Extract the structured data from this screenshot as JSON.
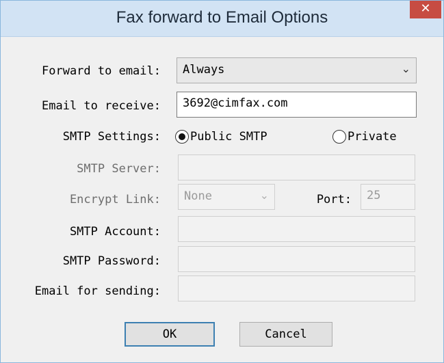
{
  "window": {
    "title": "Fax forward to Email Options",
    "close_glyph": "✕"
  },
  "form": {
    "forward_label": "Forward to email:",
    "forward_value": "Always",
    "forward_arrow": "⌄",
    "email_receive_label": "Email to receive:",
    "email_receive_value": "3692@cimfax.com",
    "smtp_settings_label": "SMTP Settings:",
    "smtp_public_label": "Public SMTP",
    "smtp_public_checked": true,
    "smtp_private_label": "Private",
    "smtp_private_checked": false,
    "smtp_server_label": "SMTP Server:",
    "smtp_server_value": "",
    "encrypt_label": "Encrypt Link:",
    "encrypt_value": "None",
    "encrypt_arrow": "⌄",
    "port_label": "Port:",
    "port_value": "25",
    "smtp_account_label": "SMTP Account:",
    "smtp_account_value": "",
    "smtp_password_label": "SMTP Password:",
    "smtp_password_value": "",
    "email_sending_label": "Email for sending:",
    "email_sending_value": ""
  },
  "buttons": {
    "ok": "OK",
    "cancel": "Cancel"
  },
  "colors": {
    "titlebar": "#d2e3f4",
    "close": "#c74c42",
    "default_border": "#3c7fb1"
  }
}
